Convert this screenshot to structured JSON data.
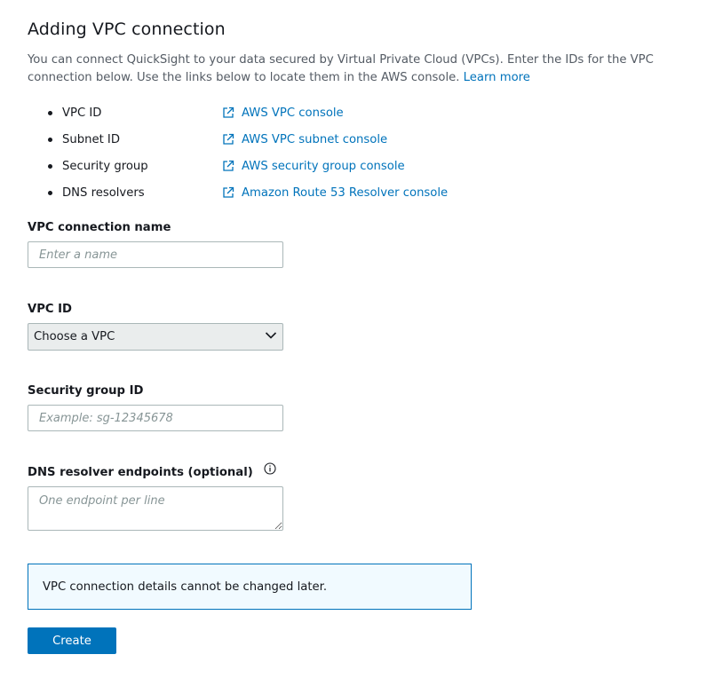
{
  "page": {
    "title": "Adding VPC connection",
    "description": "You can connect QuickSight to your data secured by Virtual Private Cloud (VPCs). Enter the IDs for the VPC connection below. Use the links below to locate them in the AWS console.",
    "learn_more": "Learn more"
  },
  "links": [
    {
      "label": "VPC ID",
      "link_text": "AWS VPC console",
      "icon": "external-link-icon"
    },
    {
      "label": "Subnet ID",
      "link_text": "AWS VPC subnet console",
      "icon": "external-link-icon"
    },
    {
      "label": "Security group",
      "link_text": "AWS security group console",
      "icon": "external-link-icon"
    },
    {
      "label": "DNS resolvers",
      "link_text": "Amazon Route 53 Resolver console",
      "icon": "external-link-icon"
    }
  ],
  "form": {
    "name_label": "VPC connection name",
    "name_placeholder": "Enter a name",
    "vpc_label": "VPC ID",
    "vpc_selected": "Choose a VPC",
    "sg_label": "Security group ID",
    "sg_placeholder": "Example: sg-12345678",
    "dns_label": "DNS resolver endpoints (optional)",
    "dns_placeholder": "One endpoint per line"
  },
  "alert": {
    "text": "VPC connection details cannot be changed later."
  },
  "actions": {
    "create_label": "Create"
  },
  "colors": {
    "link": "#0073bb",
    "primary_button": "#0073bb",
    "alert_border": "#0073bb",
    "alert_background": "#f1faff"
  }
}
